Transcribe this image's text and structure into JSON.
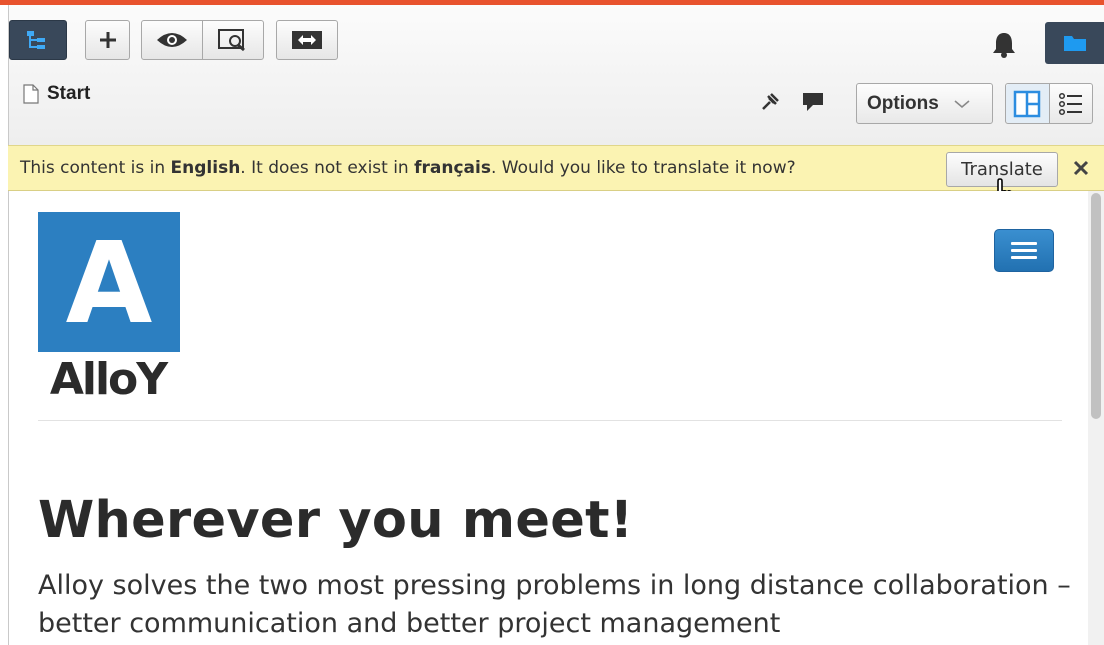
{
  "toolbar": {
    "icons": [
      "tree-icon",
      "plus-icon",
      "eye-icon",
      "preview-icon",
      "compare-icon",
      "bell-icon",
      "folder-icon"
    ]
  },
  "breadcrumb": {
    "page_name": "Start"
  },
  "actions": {
    "options_label": "Options"
  },
  "notice": {
    "text_before": "This content is in ",
    "source_language": "English",
    "text_middle": ". It does not exist in ",
    "target_language": "français",
    "text_after": ". Would you like to translate it now?",
    "translate_label": "Translate"
  },
  "page": {
    "logo_letter": "A",
    "logo_word": "AlloY",
    "headline": "Wherever you meet!",
    "lead": "Alloy solves the two most pressing problems in long distance collaboration – better communication and better project management"
  },
  "colors": {
    "accent_bar": "#e8532e",
    "toolbar_dark": "#39485a",
    "notice_bg": "#fbf3b2",
    "logo_blue": "#2c7fc1",
    "menu_button": "#2271b1"
  }
}
